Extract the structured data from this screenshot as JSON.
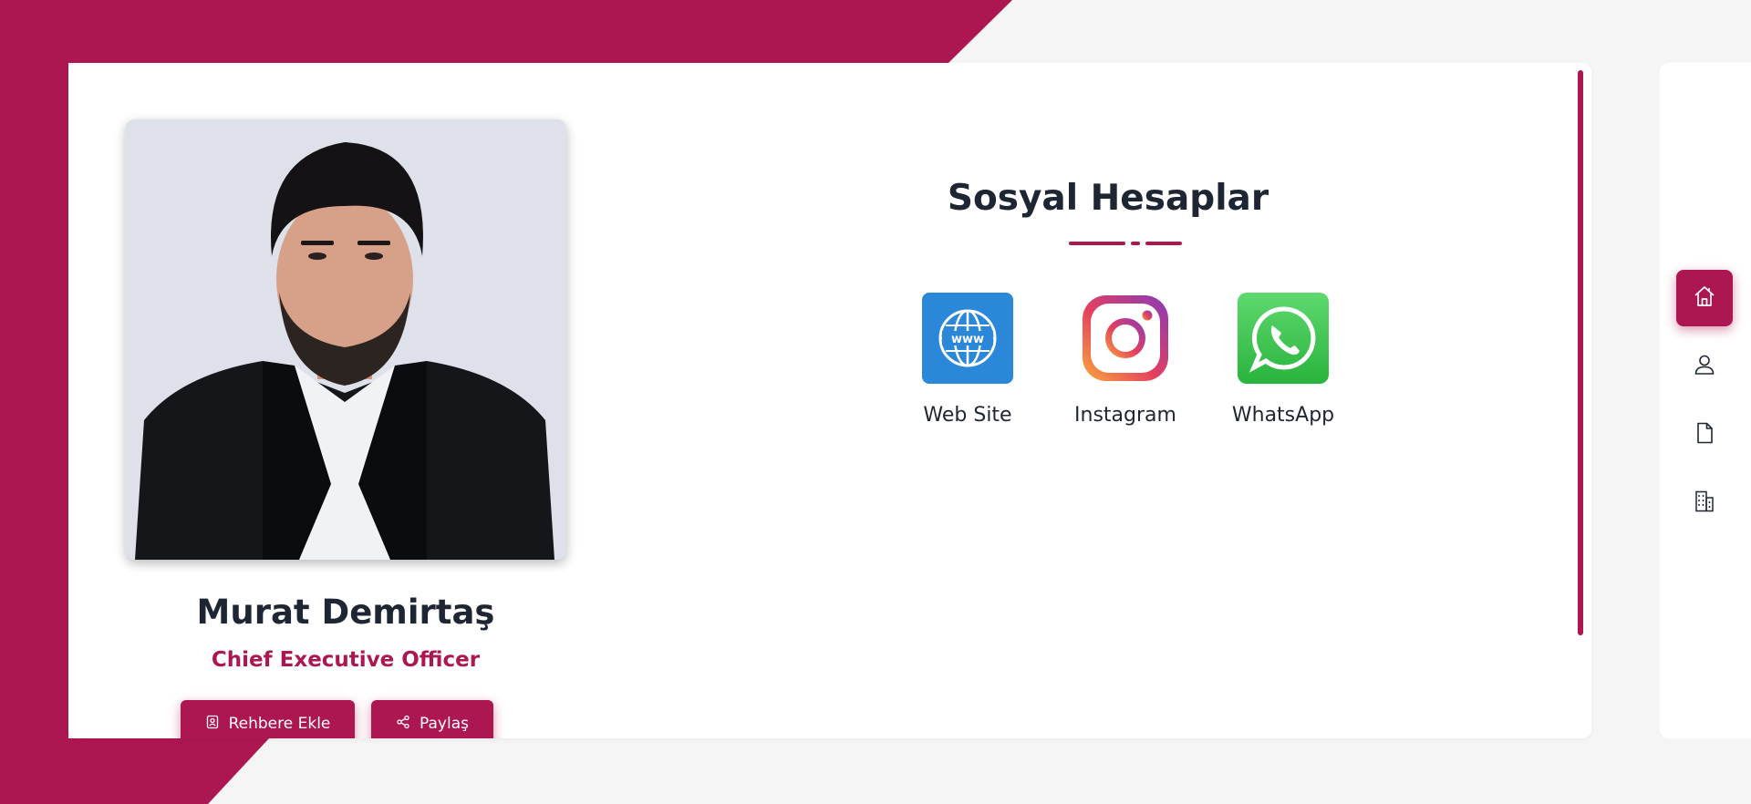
{
  "profile": {
    "name": "Murat Demirtaş",
    "title": "Chief Executive Officer",
    "add_contact_label": "Rehbere Ekle",
    "share_label": "Paylaş"
  },
  "social_section": {
    "title": "Sosyal Hesaplar",
    "items": [
      {
        "label": "Web Site",
        "icon": "globe-icon"
      },
      {
        "label": "Instagram",
        "icon": "instagram-icon"
      },
      {
        "label": "WhatsApp",
        "icon": "whatsapp-icon"
      }
    ]
  },
  "sidebar": {
    "items": [
      {
        "icon": "home-icon",
        "active": true
      },
      {
        "icon": "user-icon",
        "active": false
      },
      {
        "icon": "document-icon",
        "active": false
      },
      {
        "icon": "building-icon",
        "active": false
      }
    ]
  },
  "colors": {
    "accent": "#ac1751",
    "text_dark": "#1f2633",
    "background": "#f5f5f5",
    "web_tile": "#2b88d9",
    "whatsapp_tile": "#3cc24b"
  }
}
